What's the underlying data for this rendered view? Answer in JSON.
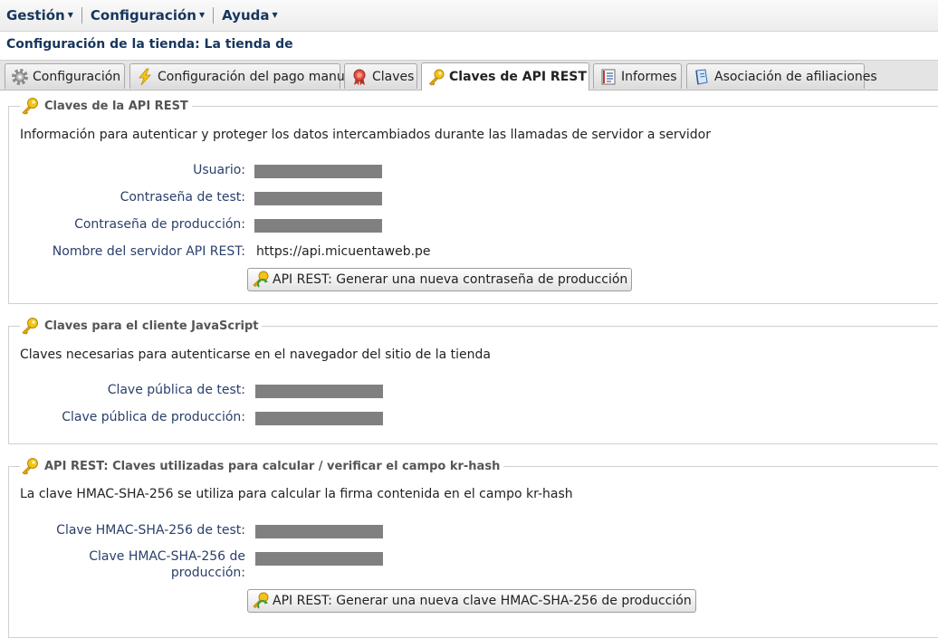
{
  "menu": {
    "items": [
      {
        "label": "Gestión"
      },
      {
        "label": "Configuración"
      },
      {
        "label": "Ayuda"
      }
    ]
  },
  "page": {
    "title": "Configuración de la tienda: La tienda de"
  },
  "tabs": [
    {
      "label": "Configuración",
      "icon": "gear-icon"
    },
    {
      "label": "Configuración del pago manual",
      "icon": "lightning-icon"
    },
    {
      "label": "Claves",
      "icon": "ribbon-icon"
    },
    {
      "label": "Claves de API REST",
      "icon": "key-icon",
      "active": true
    },
    {
      "label": "Informes",
      "icon": "report-icon"
    },
    {
      "label": "Asociación de afiliaciones",
      "icon": "book-icon"
    }
  ],
  "rest_keys": {
    "legend": "Claves de la API REST",
    "description": "Información para autenticar y proteger los datos intercambiados durante las llamadas de servidor a servidor",
    "user_label": "Usuario:",
    "test_password_label": "Contraseña de test:",
    "prod_password_label": "Contraseña de producción:",
    "server_label": "Nombre del servidor API REST:",
    "server_value": "https://api.micuentaweb.pe",
    "generate_button": "API REST: Generar una nueva contraseña de producción"
  },
  "js_keys": {
    "legend": "Claves para el cliente JavaScript",
    "description": "Claves necesarias para autenticarse en el navegador del sitio de la tienda",
    "public_test_label": "Clave pública de test:",
    "public_prod_label": "Clave pública de producción:"
  },
  "hmac_keys": {
    "legend": "API REST: Claves utilizadas para calcular / verificar el campo kr-hash",
    "description": "La clave HMAC-SHA-256 se utiliza para calcular la firma contenida en el campo kr-hash",
    "test_label": "Clave HMAC-SHA-256 de test:",
    "prod_label_line1": "Clave HMAC-SHA-256 de",
    "prod_label_line2": "producción:",
    "generate_button": "API REST: Generar una nueva clave HMAC-SHA-256 de producción"
  },
  "colors": {
    "menu_text": "#17365d",
    "label_text": "#2a3f6b",
    "mask": "#808080"
  }
}
